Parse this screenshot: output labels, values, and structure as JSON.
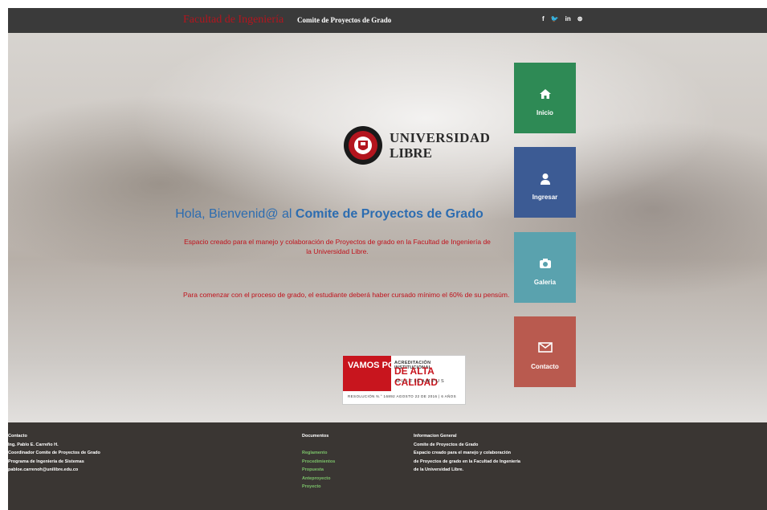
{
  "header": {
    "brand_main": "Facultad de Ingeniería",
    "brand_sub": "Comite de Proyectos de Grado",
    "social": [
      "f",
      "🐦",
      "in",
      "⊛"
    ]
  },
  "logo": {
    "line1": "UNIVERSIDAD",
    "line2": "LIBRE"
  },
  "main": {
    "greeting_prefix": "Hola, Bienvenid@ al",
    "greeting_highlight": "Comite de Proyectos de Grado",
    "description": "Espacio creado para el manejo y colaboración de Proyectos de grado en la Facultad de Ingeniería de la Universidad Libre.",
    "note": "Para comenzar con el proceso de grado, el estudiante deberá haber cursado mínimo el 60% de su pensúm."
  },
  "badge": {
    "vamos": "VAMOS POR MÁS",
    "acreditacion": "ACREDITACIÓN INSTITUCIONAL",
    "calidad": "DE ALTA CALIDAD",
    "multicampus": "MULTICAMPUS",
    "resolucion": "RESOLUCIÓN N.° 16892 AGOSTO 22 DE 2016 | 6 AÑOS"
  },
  "tiles": [
    {
      "label": "Inicio",
      "icon": "home-icon",
      "color": "#2e8a55"
    },
    {
      "label": "Ingresar",
      "icon": "user-icon",
      "color": "#3c5b94"
    },
    {
      "label": "Galeria",
      "icon": "camera-icon",
      "color": "#5aa2ae"
    },
    {
      "label": "Contacto",
      "icon": "mail-icon",
      "color": "#b95a4f"
    }
  ],
  "footer": {
    "contacto": {
      "heading": "Contacto",
      "lines": [
        "Ing. Pablo E. Carreño H.",
        "Coordinador Comite de Proyectos de Grado",
        "Programa de Ingeniería de Sistemas",
        "pabloe.carrenoh@unilibre.edu.co"
      ]
    },
    "documentos": {
      "heading": "Documentos",
      "links": [
        "Reglamento",
        "Procedimientos",
        "Propuesta",
        "Anteproyecto",
        "Proyecto"
      ]
    },
    "info": {
      "heading": "Informacion General",
      "lines": [
        "Comite de Proyectos de Grado",
        "Espacio creado para el manejo y colaboración",
        "de Proyectos de grado en la Facultad de Ingeniería",
        "de la Universidad Libre."
      ]
    }
  }
}
